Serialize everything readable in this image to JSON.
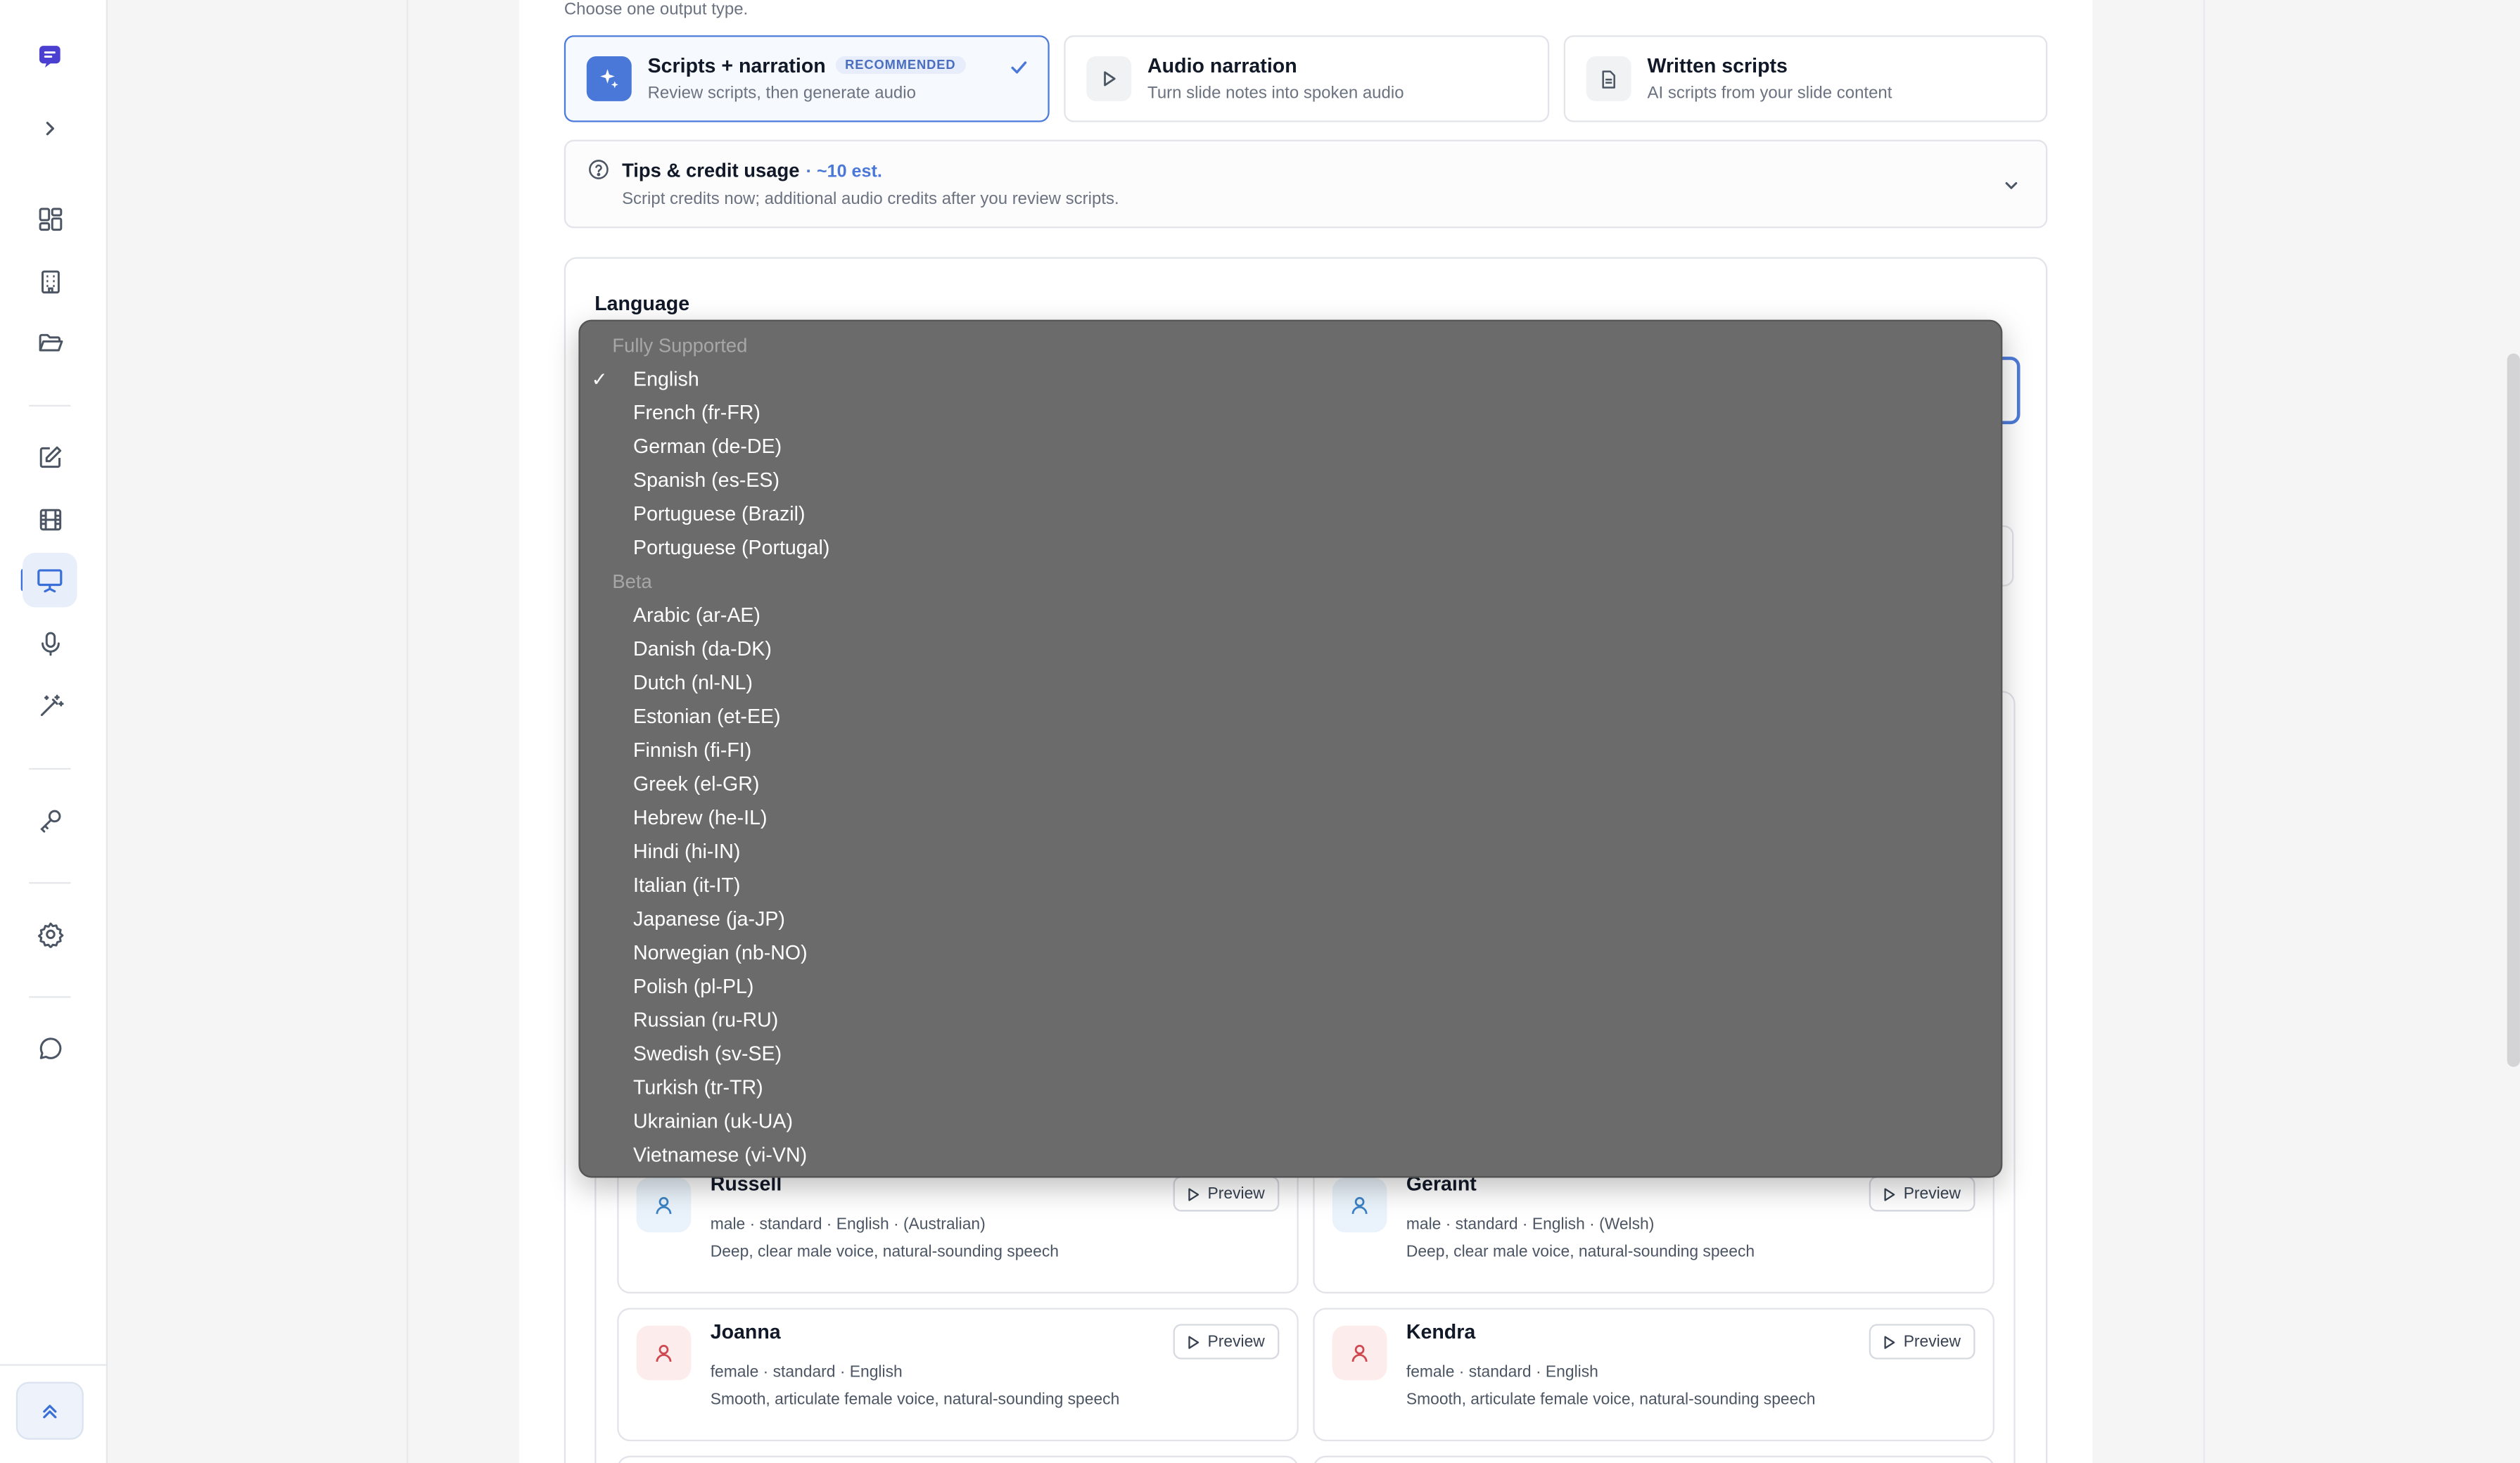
{
  "output_type": {
    "hint": "Choose one output type.",
    "options": [
      {
        "title": "Scripts + narration",
        "badge": "RECOMMENDED",
        "subtitle": "Review scripts, then generate audio",
        "icon": "sparkles-icon",
        "selected": true
      },
      {
        "title": "Audio narration",
        "subtitle": "Turn slide notes into spoken audio",
        "icon": "play-icon",
        "selected": false
      },
      {
        "title": "Written scripts",
        "subtitle": "AI scripts from your slide content",
        "icon": "document-icon",
        "selected": false
      }
    ]
  },
  "tips": {
    "title": "Tips & credit usage",
    "estimate": "· ~10 est.",
    "subtitle": "Script credits now; additional audio credits after you review scripts."
  },
  "language": {
    "label": "Language",
    "selected": "English",
    "groups": [
      {
        "name": "Fully Supported",
        "items": [
          "English",
          "French (fr-FR)",
          "German (de-DE)",
          "Spanish (es-ES)",
          "Portuguese (Brazil)",
          "Portuguese (Portugal)"
        ]
      },
      {
        "name": "Beta",
        "items": [
          "Arabic (ar-AE)",
          "Danish (da-DK)",
          "Dutch (nl-NL)",
          "Estonian (et-EE)",
          "Finnish (fi-FI)",
          "Greek (el-GR)",
          "Hebrew (he-IL)",
          "Hindi (hi-IN)",
          "Italian (it-IT)",
          "Japanese (ja-JP)",
          "Norwegian (nb-NO)",
          "Polish (pl-PL)",
          "Russian (ru-RU)",
          "Swedish (sv-SE)",
          "Turkish (tr-TR)",
          "Ukrainian (uk-UA)",
          "Vietnamese (vi-VN)"
        ]
      }
    ]
  },
  "voices": [
    {
      "name": "Russell",
      "meta": "male · standard · English · (Australian)",
      "desc": "Deep, clear male voice, natural-sounding speech",
      "gender": "male"
    },
    {
      "name": "Geraint",
      "meta": "male · standard · English · (Welsh)",
      "desc": "Deep, clear male voice, natural-sounding speech",
      "gender": "male"
    },
    {
      "name": "Joanna",
      "meta": "female · standard · English",
      "desc": "Smooth, articulate female voice, natural-sounding speech",
      "gender": "female"
    },
    {
      "name": "Kendra",
      "meta": "female · standard · English",
      "desc": "Smooth, articulate female voice, natural-sounding speech",
      "gender": "female"
    }
  ],
  "preview_label": "Preview",
  "colors": {
    "accent": "#4a78d8",
    "dropdown_bg": "#6b6b6b",
    "male_icon": "#3b82c4",
    "female_icon": "#d0484f"
  },
  "rail_icons": [
    "app-logo-icon",
    "chevron-right-icon",
    "dashboard-icon",
    "building-icon",
    "folder-icon",
    "edit-icon",
    "film-icon",
    "presentation-icon",
    "microphone-icon",
    "magic-wand-icon",
    "key-icon",
    "settings-icon",
    "chat-icon",
    "scroll-up-icon"
  ]
}
